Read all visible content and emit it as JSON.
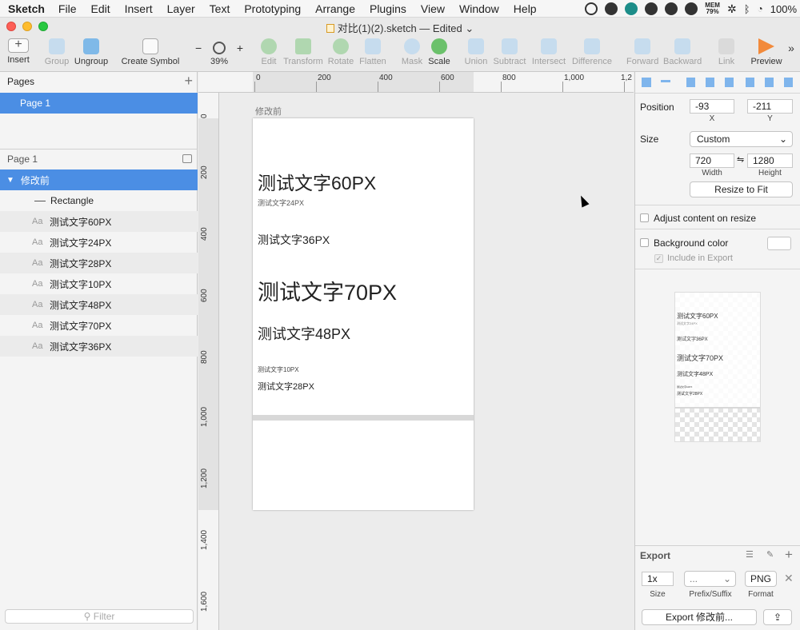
{
  "menubar": {
    "app": "Sketch",
    "items": [
      "File",
      "Edit",
      "Insert",
      "Layer",
      "Text",
      "Prototyping",
      "Arrange",
      "Plugins",
      "View",
      "Window",
      "Help"
    ],
    "mem_label": "MEM",
    "mem_value": "79%",
    "battery": "100%"
  },
  "window": {
    "title": "对比(1)(2).sketch — Edited"
  },
  "toolbar": {
    "insert": "Insert",
    "group": "Group",
    "ungroup": "Ungroup",
    "create_symbol": "Create Symbol",
    "zoom_value": "39%",
    "zoom_minus": "−",
    "zoom_plus": "+",
    "edit": "Edit",
    "transform": "Transform",
    "rotate": "Rotate",
    "flatten": "Flatten",
    "mask": "Mask",
    "scale": "Scale",
    "union": "Union",
    "subtract": "Subtract",
    "intersect": "Intersect",
    "difference": "Difference",
    "forward": "Forward",
    "backward": "Backward",
    "link": "Link",
    "preview": "Preview",
    "more": "»"
  },
  "pages": {
    "header": "Pages",
    "add": "+",
    "items": [
      "Page 1"
    ]
  },
  "layers": {
    "header": "Page 1",
    "artboard": "修改前",
    "items": [
      {
        "icon": "shape",
        "label": "Rectangle"
      },
      {
        "icon": "Aa",
        "label": "测试文字60PX"
      },
      {
        "icon": "Aa",
        "label": "测试文字24PX"
      },
      {
        "icon": "Aa",
        "label": "测试文字28PX"
      },
      {
        "icon": "Aa",
        "label": "测试文字10PX"
      },
      {
        "icon": "Aa",
        "label": "测试文字48PX"
      },
      {
        "icon": "Aa",
        "label": "测试文字70PX"
      },
      {
        "icon": "Aa",
        "label": "测试文字36PX"
      }
    ],
    "filter_placeholder": "Filter"
  },
  "rulers": {
    "horizontal": [
      "0",
      "200",
      "400",
      "600",
      "800",
      "1,000",
      "1,2"
    ],
    "vertical": [
      "0",
      "200",
      "400",
      "600",
      "800",
      "1,000",
      "1,200",
      "1,400",
      "1,600"
    ]
  },
  "canvas": {
    "artboard_label": "修改前",
    "texts": [
      {
        "text": "测试文字60PX"
      },
      {
        "text": "测试文字24PX"
      },
      {
        "text": "测试文字36PX"
      },
      {
        "text": "测试文字70PX"
      },
      {
        "text": "测试文字48PX"
      },
      {
        "text": "测试文字10PX"
      },
      {
        "text": "测试文字28PX"
      }
    ]
  },
  "inspector": {
    "position_label": "Position",
    "x_value": "-93",
    "y_value": "-211",
    "x_label": "X",
    "y_label": "Y",
    "size_label": "Size",
    "size_preset": "Custom",
    "width_value": "720",
    "height_value": "1280",
    "width_label": "Width",
    "height_label": "Height",
    "resize_to_fit": "Resize to Fit",
    "adjust_content": "Adjust content on resize",
    "background_color": "Background color",
    "include_in_export": "Include in Export",
    "preview_texts": [
      "测试文字60PX",
      "测试文字24PX",
      "测试文字36PX",
      "测试文字70PX",
      "测试文字48PX",
      "测试文字10PX",
      "测试文字28PX"
    ],
    "export_header": "Export",
    "export_scale": "1x",
    "export_prefix": "...",
    "export_format": "PNG",
    "scale_label": "Size",
    "prefix_label": "Prefix/Suffix",
    "format_label": "Format",
    "export_button": "Export 修改前..."
  },
  "colors": {
    "selection_blue": "#4b8ee4",
    "toolbar_bg": "#e9e9e9",
    "canvas_bg": "#ececec"
  }
}
